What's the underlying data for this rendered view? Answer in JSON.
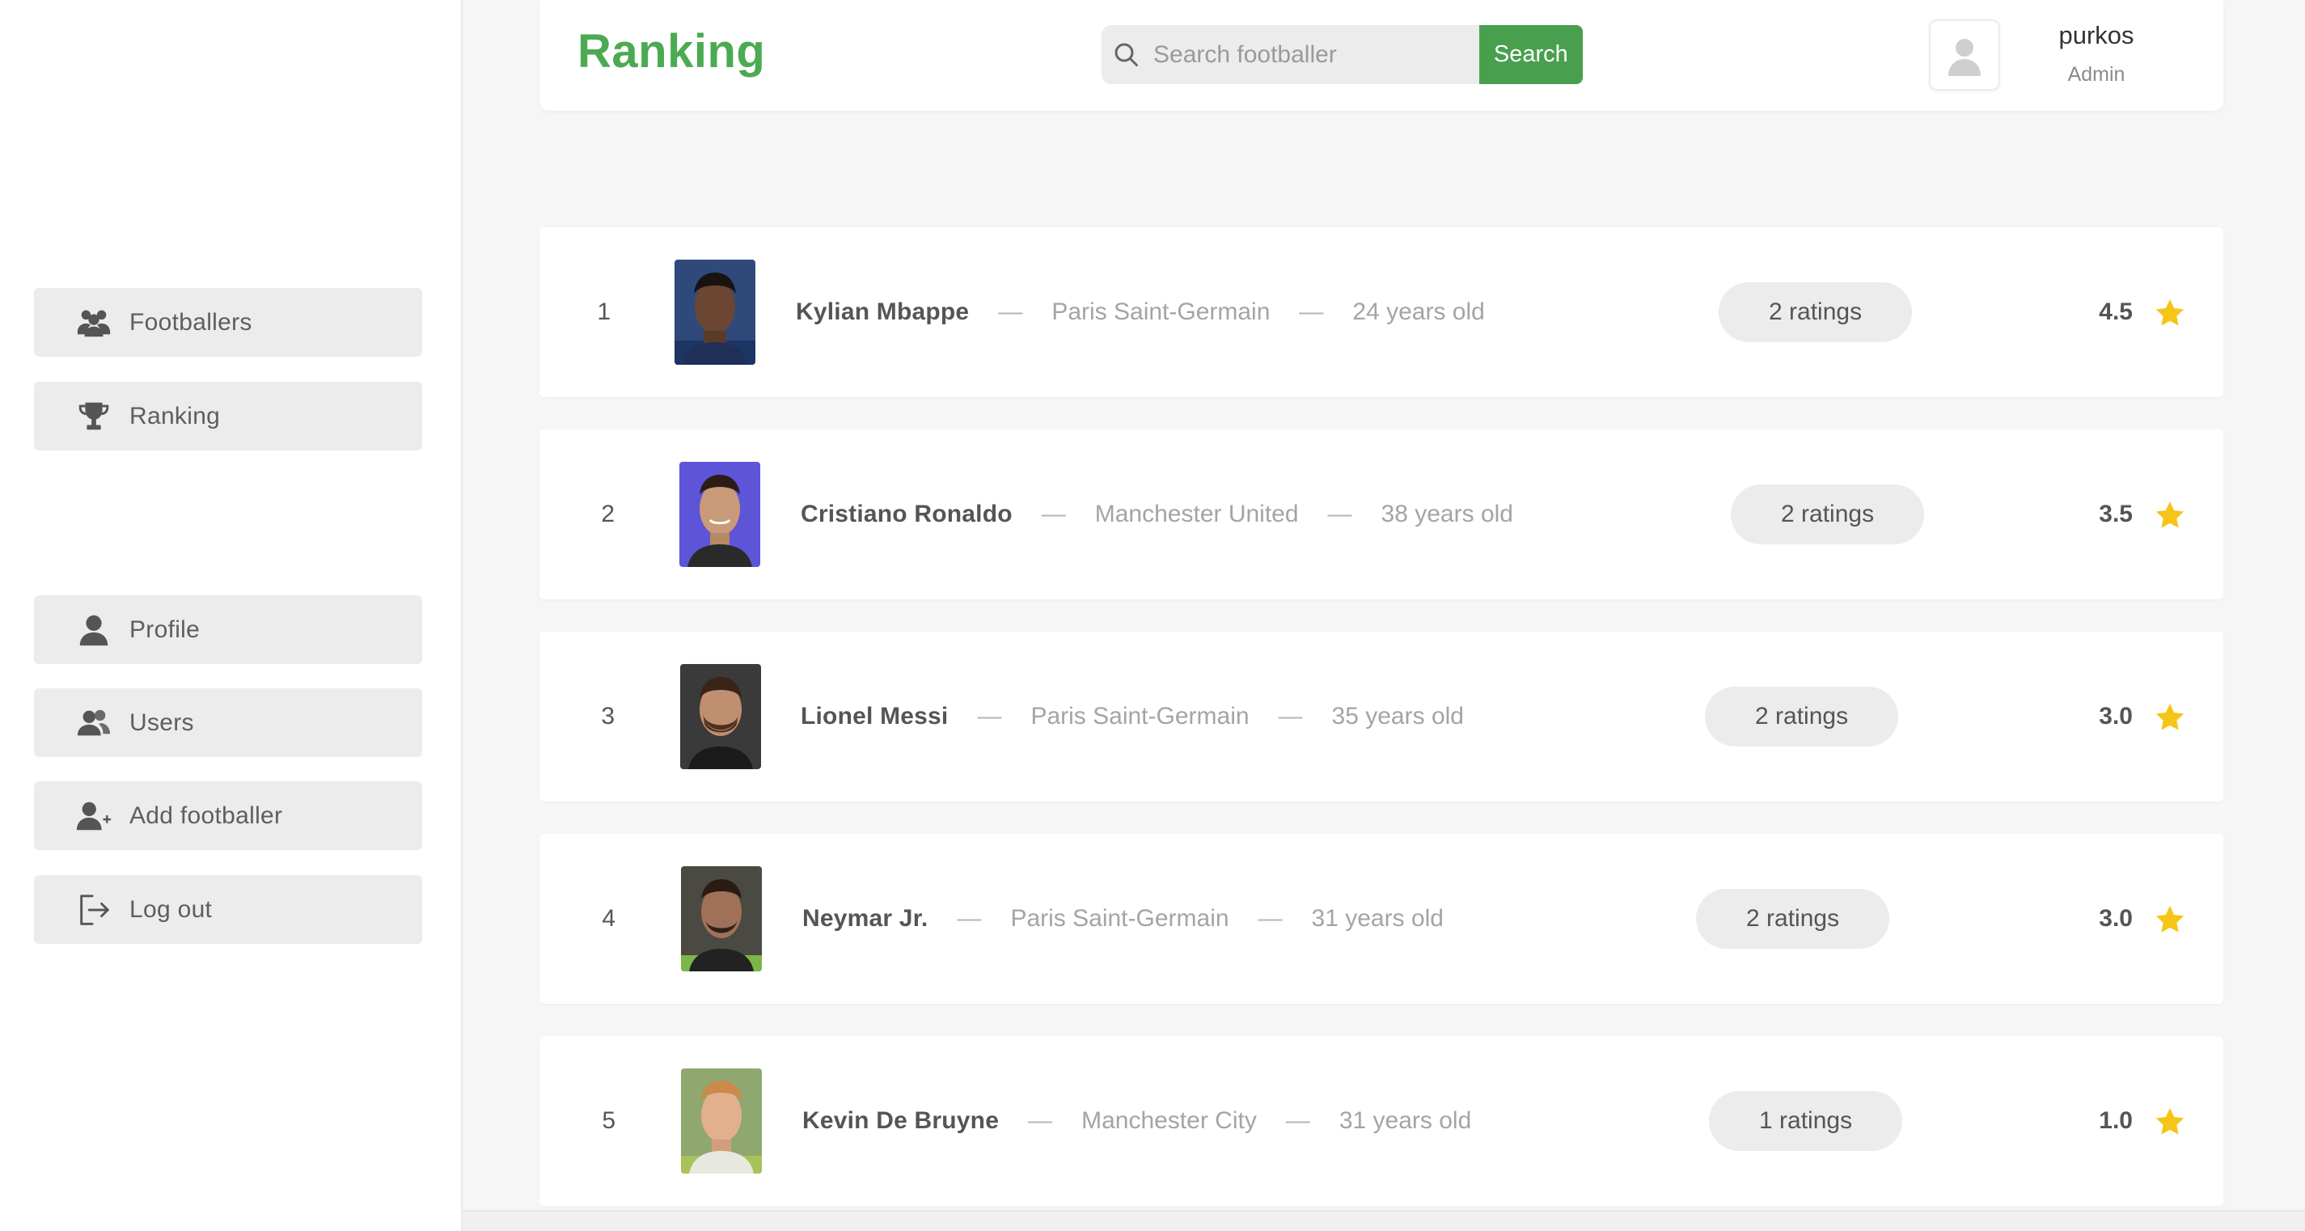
{
  "sidebar": {
    "items": [
      {
        "label": "Footballers",
        "icon": "users-group-icon"
      },
      {
        "label": "Ranking",
        "icon": "trophy-icon"
      },
      {
        "label": "Profile",
        "icon": "user-icon"
      },
      {
        "label": "Users",
        "icon": "users-icon"
      },
      {
        "label": "Add footballer",
        "icon": "user-plus-icon"
      },
      {
        "label": "Log out",
        "icon": "logout-icon"
      }
    ]
  },
  "header": {
    "title": "Ranking",
    "search": {
      "placeholder": "Search footballer",
      "value": "",
      "button_label": "Search"
    },
    "user": {
      "name": "purkos",
      "role": "Admin"
    }
  },
  "ranking": [
    {
      "rank": "1",
      "name": "Kylian Mbappe",
      "club": "Paris Saint-Germain",
      "age": "24 years old",
      "ratings": "2 ratings",
      "score": "4.5"
    },
    {
      "rank": "2",
      "name": "Cristiano Ronaldo",
      "club": "Manchester United",
      "age": "38 years old",
      "ratings": "2 ratings",
      "score": "3.5"
    },
    {
      "rank": "3",
      "name": "Lionel Messi",
      "club": "Paris Saint-Germain",
      "age": "35 years old",
      "ratings": "2 ratings",
      "score": "3.0"
    },
    {
      "rank": "4",
      "name": "Neymar Jr.",
      "club": "Paris Saint-Germain",
      "age": "31 years old",
      "ratings": "2 ratings",
      "score": "3.0"
    },
    {
      "rank": "5",
      "name": "Kevin De Bruyne",
      "club": "Manchester City",
      "age": "31 years old",
      "ratings": "1 ratings",
      "score": "1.0"
    }
  ],
  "separator": "—",
  "colors": {
    "accent": "#4caa52",
    "search_button": "#48a04f",
    "star": "#f5c518",
    "pill": "#ececec"
  }
}
